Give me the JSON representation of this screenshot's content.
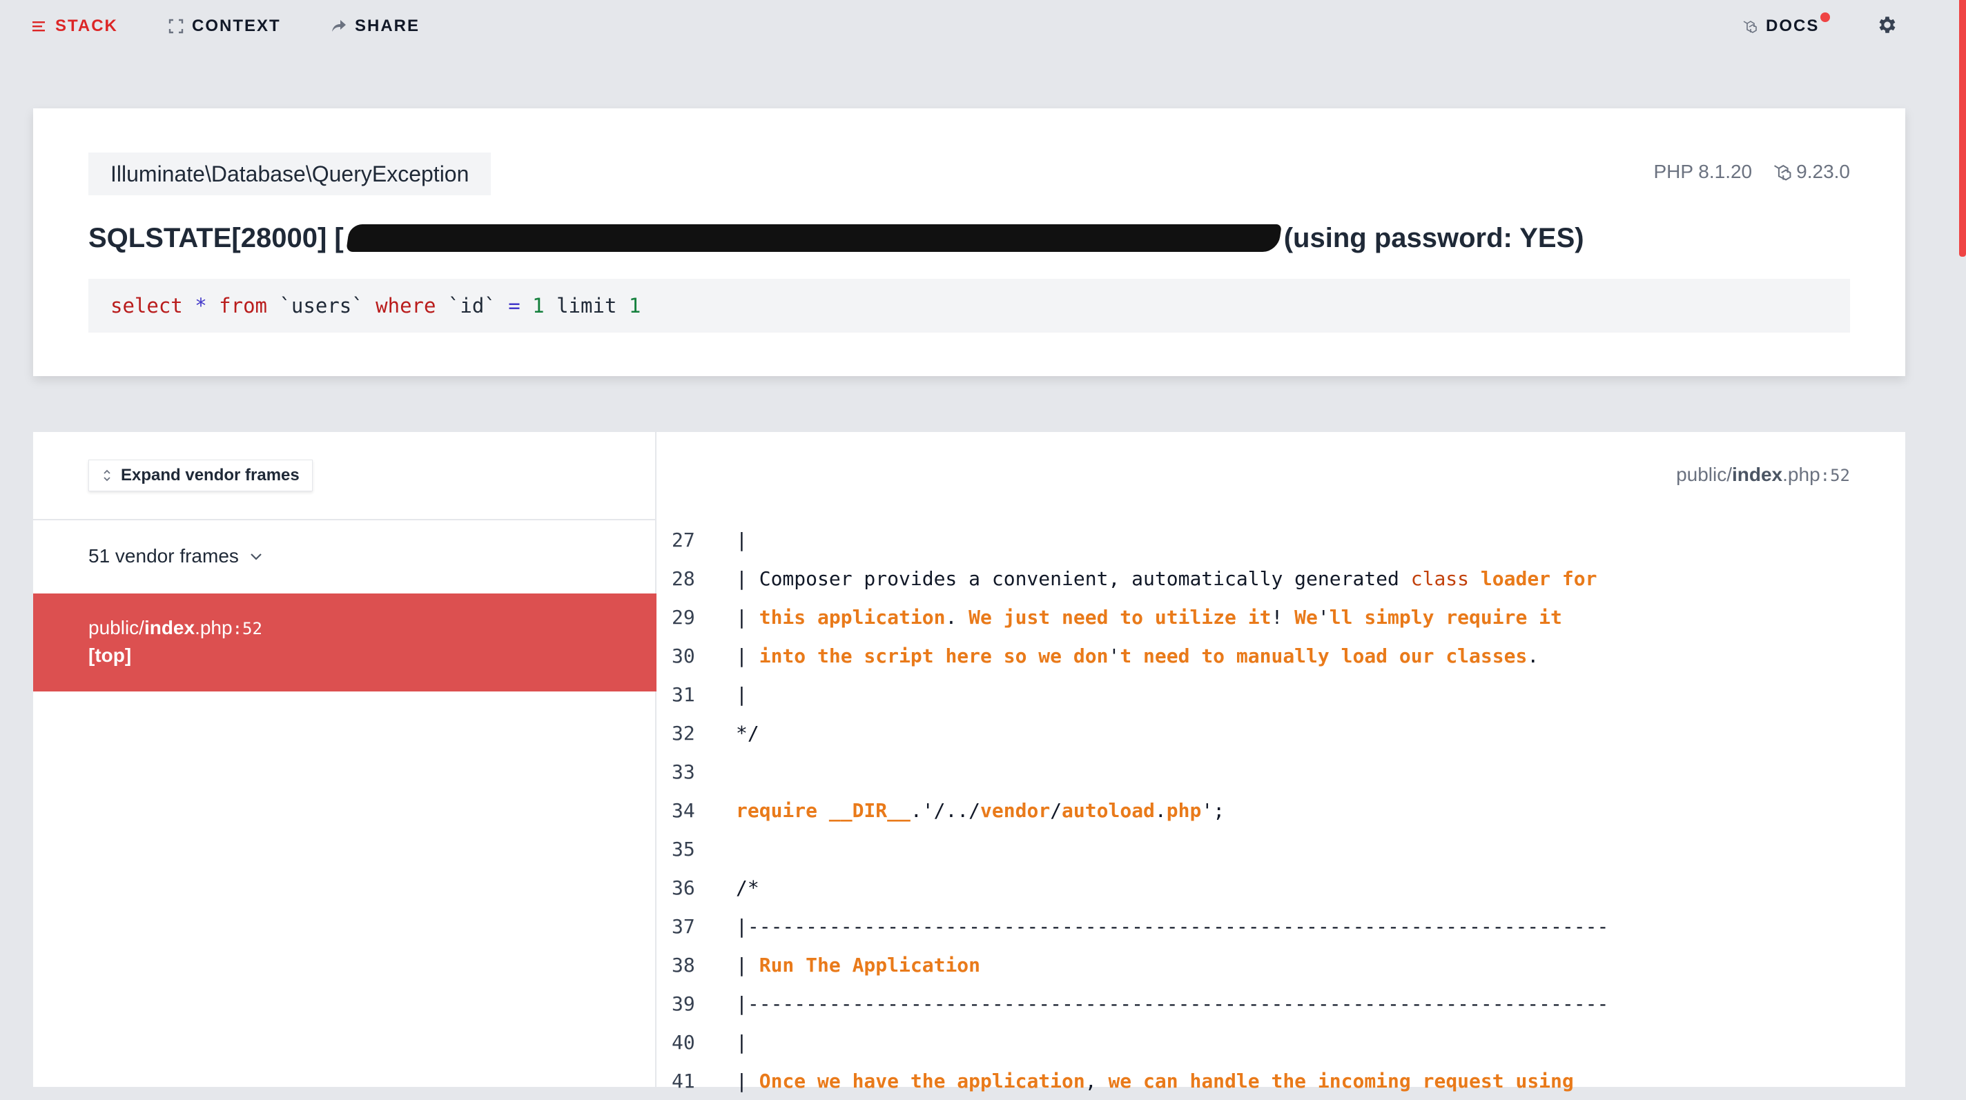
{
  "nav": {
    "stack": "STACK",
    "context": "CONTEXT",
    "share": "SHARE",
    "docs": "DOCS"
  },
  "header": {
    "exception_class": "Illuminate\\Database\\QueryException",
    "php_version": "PHP 8.1.20",
    "laravel_version": "9.23.0",
    "message_prefix": "SQLSTATE[28000] [",
    "message_suffix": "(using password: YES)",
    "sql": [
      {
        "t": "select",
        "c": "kw"
      },
      {
        "t": " ",
        "c": "plain"
      },
      {
        "t": "*",
        "c": "op"
      },
      {
        "t": " ",
        "c": "plain"
      },
      {
        "t": "from",
        "c": "kw"
      },
      {
        "t": " `users` ",
        "c": "plain"
      },
      {
        "t": "where",
        "c": "kw"
      },
      {
        "t": " `id` ",
        "c": "plain"
      },
      {
        "t": "=",
        "c": "op"
      },
      {
        "t": " ",
        "c": "plain"
      },
      {
        "t": "1",
        "c": "num"
      },
      {
        "t": " limit ",
        "c": "plain"
      },
      {
        "t": "1",
        "c": "num"
      }
    ]
  },
  "stack": {
    "expand_label": "Expand vendor frames",
    "vendor_frames_label": "51 vendor frames",
    "active_frame": {
      "path_prefix": "public/",
      "path_file": "index",
      "path_ext": ".php",
      "line": ":52",
      "tag": "[top]"
    },
    "file": {
      "path_prefix": "public/",
      "path_file": "index",
      "path_ext": ".php",
      "line": ":52"
    },
    "code_lines": [
      {
        "n": "27",
        "parts": [
          {
            "t": "|",
            "c": "txt"
          }
        ]
      },
      {
        "n": "28",
        "parts": [
          {
            "t": "| Composer provides a convenient, automatically generated ",
            "c": "txt"
          },
          {
            "t": "class",
            "c": "cls"
          },
          {
            "t": " ",
            "c": "txt"
          },
          {
            "t": "loader for",
            "c": "cmt"
          }
        ]
      },
      {
        "n": "29",
        "parts": [
          {
            "t": "| ",
            "c": "txt"
          },
          {
            "t": "this application",
            "c": "cmt"
          },
          {
            "t": ". ",
            "c": "txt"
          },
          {
            "t": "We just need to utilize it",
            "c": "cmt"
          },
          {
            "t": "! ",
            "c": "txt"
          },
          {
            "t": "We",
            "c": "cmt"
          },
          {
            "t": "'",
            "c": "txt"
          },
          {
            "t": "ll simply require it",
            "c": "cmt"
          }
        ]
      },
      {
        "n": "30",
        "parts": [
          {
            "t": "| ",
            "c": "txt"
          },
          {
            "t": "into the script here so we don",
            "c": "cmt"
          },
          {
            "t": "'",
            "c": "txt"
          },
          {
            "t": "t need to manually load our classes",
            "c": "cmt"
          },
          {
            "t": ".",
            "c": "txt"
          }
        ]
      },
      {
        "n": "31",
        "parts": [
          {
            "t": "|",
            "c": "txt"
          }
        ]
      },
      {
        "n": "32",
        "parts": [
          {
            "t": "*/",
            "c": "txt"
          }
        ]
      },
      {
        "n": "33",
        "parts": [
          {
            "t": "",
            "c": "txt"
          }
        ]
      },
      {
        "n": "34",
        "parts": [
          {
            "t": "require __DIR__",
            "c": "cmt"
          },
          {
            "t": ".'/../",
            "c": "txt"
          },
          {
            "t": "vendor",
            "c": "cmt"
          },
          {
            "t": "/",
            "c": "txt"
          },
          {
            "t": "autoload",
            "c": "cmt"
          },
          {
            "t": ".",
            "c": "txt"
          },
          {
            "t": "php",
            "c": "cmt"
          },
          {
            "t": "';",
            "c": "txt"
          }
        ]
      },
      {
        "n": "35",
        "parts": [
          {
            "t": "",
            "c": "txt"
          }
        ]
      },
      {
        "n": "36",
        "parts": [
          {
            "t": "/*",
            "c": "txt"
          }
        ]
      },
      {
        "n": "37",
        "parts": [
          {
            "t": "|--------------------------------------------------------------------------",
            "c": "txt"
          }
        ]
      },
      {
        "n": "38",
        "parts": [
          {
            "t": "| ",
            "c": "txt"
          },
          {
            "t": "Run The Application",
            "c": "cmt"
          }
        ]
      },
      {
        "n": "39",
        "parts": [
          {
            "t": "|--------------------------------------------------------------------------",
            "c": "txt"
          }
        ]
      },
      {
        "n": "40",
        "parts": [
          {
            "t": "|",
            "c": "txt"
          }
        ]
      },
      {
        "n": "41",
        "parts": [
          {
            "t": "| ",
            "c": "txt"
          },
          {
            "t": "Once we have the application",
            "c": "cmt"
          },
          {
            "t": ", ",
            "c": "txt"
          },
          {
            "t": "we can handle the incoming request using",
            "c": "cmt"
          }
        ]
      }
    ]
  }
}
